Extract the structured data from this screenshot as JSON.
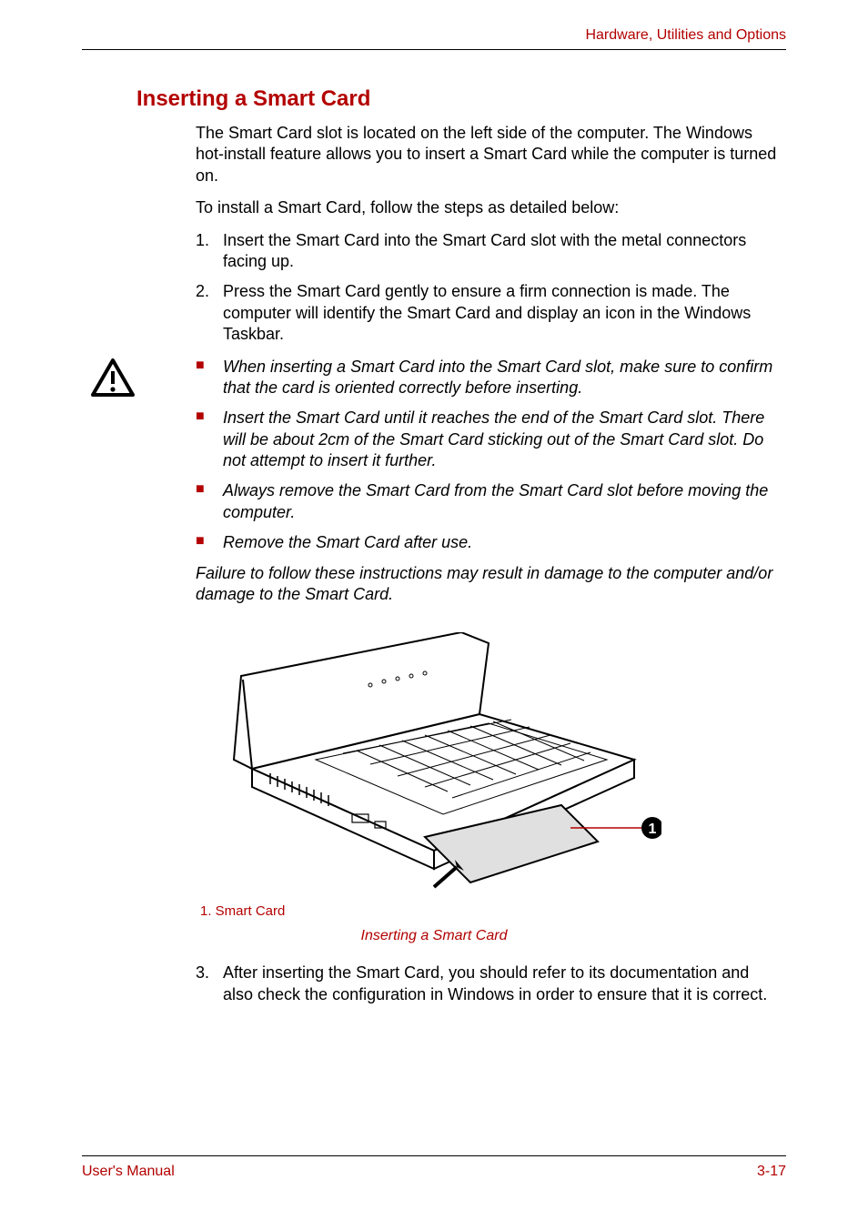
{
  "header": {
    "breadcrumb": "Hardware, Utilities and Options"
  },
  "section": {
    "title": "Inserting a Smart Card"
  },
  "intro": {
    "p1": "The Smart Card slot is located on the left side of the computer. The Windows hot-install feature allows you to insert a Smart Card while the computer is turned on.",
    "p2": "To install a Smart Card, follow the steps as detailed below:"
  },
  "steps12": [
    {
      "num": "1.",
      "text": "Insert the Smart Card into the Smart Card slot with the metal connectors facing up."
    },
    {
      "num": "2.",
      "text": "Press the Smart Card gently to ensure a firm connection is made. The computer will identify the Smart Card and display an icon in the Windows Taskbar."
    }
  ],
  "caution": {
    "bullets": [
      "When inserting a Smart Card into the Smart Card slot, make sure to confirm that the card is oriented correctly before inserting.",
      "Insert the Smart Card until it reaches the end of the Smart Card slot. There will be about 2cm of the Smart Card sticking out of the Smart Card slot. Do not attempt to insert it further.",
      "Always remove the Smart Card from the Smart Card slot before moving the computer.",
      "Remove the Smart Card after use."
    ],
    "tail": "Failure to follow these instructions may result in damage to the computer and/or damage to the Smart Card."
  },
  "figure": {
    "callout_num": "1",
    "legend": "1. Smart Card",
    "caption": "Inserting a Smart Card"
  },
  "steps3": [
    {
      "num": "3.",
      "text": "After inserting the Smart Card, you should refer to its documentation and also check the configuration in Windows in order to ensure that it is correct."
    }
  ],
  "footer": {
    "left": "User's Manual",
    "right": "3-17"
  }
}
